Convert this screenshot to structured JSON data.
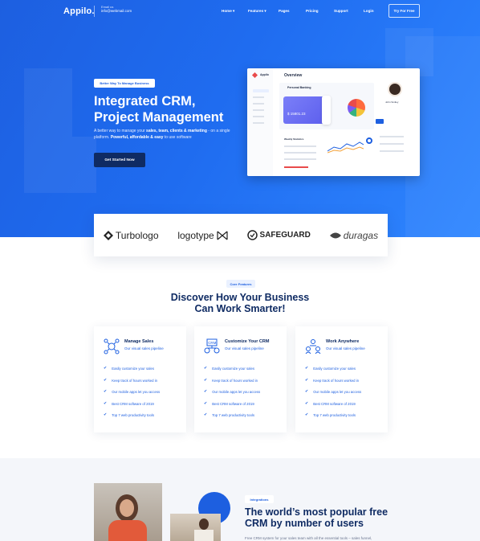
{
  "nav": {
    "logo": "Appilo.",
    "contact_label": "Email us",
    "contact_email": "info@webmail.com",
    "items": [
      "Home ▾",
      "Features ▾",
      "Pages",
      "Pricing",
      "Support",
      "Login"
    ],
    "cta": "Try For Free"
  },
  "hero": {
    "badge": "Better Way To Manage Business",
    "title_line1": "Integrated CRM,",
    "title_line2": "Project Management",
    "desc_pre": "A better way to manage your ",
    "desc_bold1": "sales, team, clients & marketing",
    "desc_mid": " - on a single platform. ",
    "desc_bold2": "Powerful, affordable & easy",
    "desc_post": " to use software",
    "cta": "Get Started Now"
  },
  "dashboard": {
    "app": "Appilo",
    "title": "Overview",
    "card_title": "Personal Banking",
    "balance": "$ 15801.23",
    "user_name": "John Smiley",
    "section": "Weekly Statistics",
    "colors": {
      "accent": "#1d5fe0",
      "card": "#6a6cf2"
    }
  },
  "logos": [
    "Turbologo",
    "logotype",
    "SAFEGUARD",
    "duragas"
  ],
  "features": {
    "badge": "Core Features",
    "title_line1": "Discover How Your Business",
    "title_line2": "Can Work Smarter!",
    "cards": [
      {
        "title": "Manage Sales",
        "subtitle": "Our visual sales pipeline",
        "icon": "sales-pipeline-icon"
      },
      {
        "title": "Customize Your CRM",
        "subtitle": "Our visual sales pipeline",
        "icon": "crm-icon"
      },
      {
        "title": "Work Anywhere",
        "subtitle": "Our visual sales pipeline",
        "icon": "team-icon"
      }
    ],
    "bullets": [
      "Easily customize your sales",
      "Keep track of hours worked in",
      "Our mobile apps let you access",
      "Best CRM software of 2019",
      "Top 7 web productivity tools"
    ]
  },
  "integrations": {
    "badge": "Integrations",
    "title_line1": "The world’s most popular free",
    "title_line2": "CRM by number of users",
    "desc": "Free CRM system for your sales team with all the essential tools – sales funnel,"
  },
  "colors": {
    "primary": "#1d5fe0",
    "dark": "#0f2b63"
  }
}
